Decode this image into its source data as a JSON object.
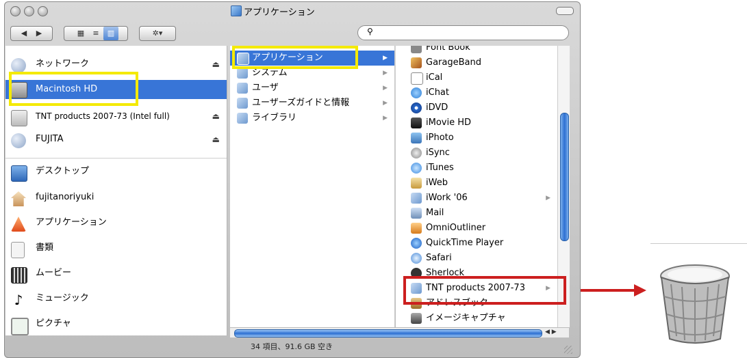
{
  "window": {
    "title": "アプリケーション",
    "status_text": "34 項目、91.6 GB 空き"
  },
  "toolbar": {
    "back_label": "◀",
    "forward_label": "▶",
    "view_icon_label": "▦",
    "view_list_label": "≡",
    "view_column_label": "▥",
    "action_label": "✲▾",
    "search_value": ""
  },
  "sidebar": {
    "devices": [
      {
        "label": "ネットワーク",
        "icon": "network-globe-icon",
        "eject": "⏏"
      },
      {
        "label": "Macintosh HD",
        "icon": "hard-disk-icon",
        "selected": true
      },
      {
        "label": "TNT products 2007-73 (Intel full)",
        "icon": "disk-image-icon",
        "eject": "⏏"
      },
      {
        "label": "FUJITA",
        "icon": "network-globe-icon",
        "eject": "⏏"
      }
    ],
    "places": [
      {
        "label": "デスクトップ",
        "icon": "desktop-icon"
      },
      {
        "label": "fujitanoriyuki",
        "icon": "home-icon"
      },
      {
        "label": "アプリケーション",
        "icon": "applications-icon"
      },
      {
        "label": "書類",
        "icon": "documents-icon"
      },
      {
        "label": "ムービー",
        "icon": "movies-icon"
      },
      {
        "label": "ミュージック",
        "icon": "music-icon"
      },
      {
        "label": "ピクチャ",
        "icon": "pictures-icon"
      }
    ]
  },
  "column1": [
    {
      "label": "アプリケーション",
      "selected": true,
      "arrow": "▶"
    },
    {
      "label": "システム",
      "arrow": "▶"
    },
    {
      "label": "ユーザ",
      "arrow": "▶"
    },
    {
      "label": "ユーザーズガイドと情報",
      "arrow": "▶"
    },
    {
      "label": "ライブラリ",
      "arrow": "▶"
    }
  ],
  "column2": [
    {
      "label": "Font Book"
    },
    {
      "label": "GarageBand"
    },
    {
      "label": "iCal"
    },
    {
      "label": "iChat"
    },
    {
      "label": "iDVD"
    },
    {
      "label": "iMovie HD"
    },
    {
      "label": "iPhoto"
    },
    {
      "label": "iSync"
    },
    {
      "label": "iTunes"
    },
    {
      "label": "iWeb"
    },
    {
      "label": "iWork '06",
      "arrow": "▶"
    },
    {
      "label": "Mail"
    },
    {
      "label": "OmniOutliner"
    },
    {
      "label": "QuickTime Player"
    },
    {
      "label": "Safari"
    },
    {
      "label": "Sherlock"
    },
    {
      "label": "TNT products 2007-73",
      "arrow": "▶"
    },
    {
      "label": "アドレスブック"
    },
    {
      "label": "イメージキャプチャ"
    }
  ],
  "colors": {
    "selection": "#3875d7",
    "highlight_yellow": "#f4ea00",
    "highlight_red": "#cc1f1f"
  }
}
